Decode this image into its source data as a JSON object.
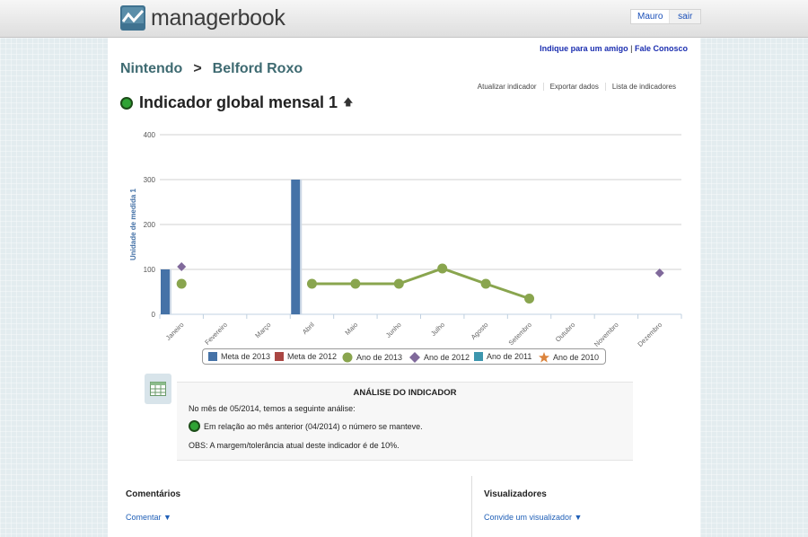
{
  "app": {
    "name": "managerbook"
  },
  "user": {
    "name": "Mauro",
    "logout": "sair"
  },
  "toplinks": {
    "recommend": "Indique para um amigo",
    "separator": "|",
    "contact": "Fale Conosco"
  },
  "breadcrumb": {
    "company": "Nintendo",
    "separator": ">",
    "unit": "Belford Roxo"
  },
  "actions": [
    "Atualizar indicador",
    "Exportar dados",
    "Lista de indicadores"
  ],
  "indicator": {
    "title": "Indicador global mensal 1",
    "trend_icon": "arrow-up-icon",
    "status_color": "#2fa334"
  },
  "chart_data": {
    "type": "bar",
    "ylabel": "Unidade de medida 1",
    "ylim": [
      0,
      400
    ],
    "yticks": [
      "0",
      "100",
      "200",
      "300",
      "400"
    ],
    "categories": [
      "Janeiro",
      "Fevereiro",
      "Março",
      "Abril",
      "Maio",
      "Junho",
      "Julho",
      "Agosto",
      "Setembro",
      "Outubro",
      "Novembro",
      "Dezembro"
    ],
    "grid": true,
    "legend_position": "bottom",
    "series": [
      {
        "name": "Meta de 2013",
        "type": "bar",
        "color": "#4572a7",
        "values": [
          100,
          null,
          null,
          300,
          null,
          null,
          null,
          null,
          null,
          null,
          null,
          null
        ]
      },
      {
        "name": "Meta de 2012",
        "type": "bar",
        "color": "#aa4643",
        "values": [
          null,
          null,
          null,
          null,
          null,
          null,
          null,
          null,
          null,
          null,
          null,
          null
        ]
      },
      {
        "name": "Ano de 2013",
        "type": "line",
        "marker": "circle",
        "color": "#89a54e",
        "values": [
          68,
          null,
          null,
          68,
          68,
          68,
          102,
          68,
          35,
          null,
          null,
          null
        ]
      },
      {
        "name": "Ano de 2012",
        "type": "scatter",
        "marker": "diamond",
        "color": "#80699b",
        "values": [
          106,
          null,
          null,
          null,
          null,
          null,
          null,
          null,
          null,
          null,
          null,
          92
        ]
      },
      {
        "name": "Ano de 2011",
        "type": "scatter",
        "marker": "square",
        "color": "#3d96ae",
        "values": [
          null,
          null,
          null,
          null,
          null,
          null,
          null,
          null,
          null,
          null,
          null,
          null
        ]
      },
      {
        "name": "Ano de 2010",
        "type": "scatter",
        "marker": "star",
        "color": "#db843d",
        "values": [
          null,
          null,
          null,
          null,
          null,
          null,
          null,
          null,
          null,
          null,
          null,
          null
        ]
      }
    ]
  },
  "analysis": {
    "title": "ANÁLISE DO INDICADOR",
    "intro": "No mês de 05/2014, temos a seguinte análise:",
    "line": "Em relação ao mês anterior (04/2014) o número se manteve.",
    "obs": "OBS: A margem/tolerância atual deste indicador é de 10%."
  },
  "comments": {
    "title": "Comentários",
    "link": "Comentar ▼"
  },
  "viewers": {
    "title": "Visualizadores",
    "link": "Convide um visualizador ▼"
  }
}
